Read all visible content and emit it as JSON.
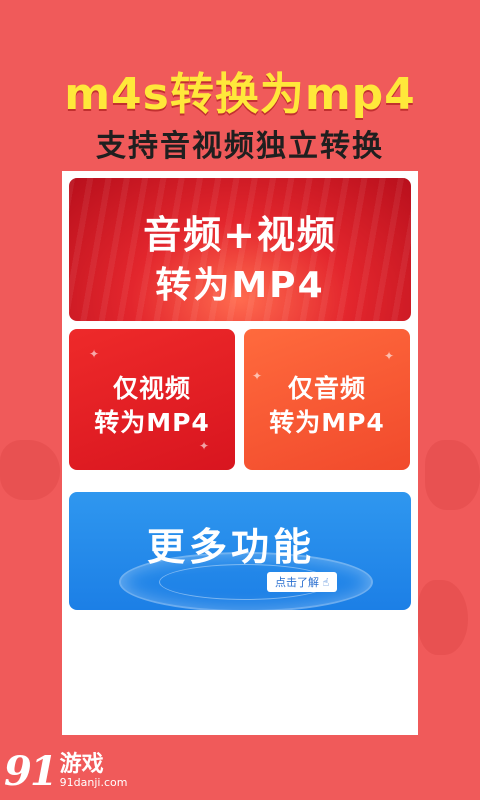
{
  "header": {
    "title": "m4s转换为mp4",
    "subtitle": "支持音视频独立转换"
  },
  "cards": {
    "main": {
      "line1": "音频+视频",
      "line2": "转为MP4"
    },
    "video_only": {
      "line1": "仅视频",
      "line2": "转为MP4"
    },
    "audio_only": {
      "line1": "仅音频",
      "line2": "转为MP4"
    },
    "more": {
      "title": "更多功能",
      "learn_more": "点击了解"
    }
  },
  "watermark": {
    "logo_number": "91",
    "logo_name": "游戏",
    "site": "91danji.com"
  },
  "colors": {
    "background": "#f05a5a",
    "headline": "#ffe83a",
    "red_card": "#e3262d",
    "orange_card": "#ff6a3d",
    "blue_card": "#2f97ef"
  }
}
